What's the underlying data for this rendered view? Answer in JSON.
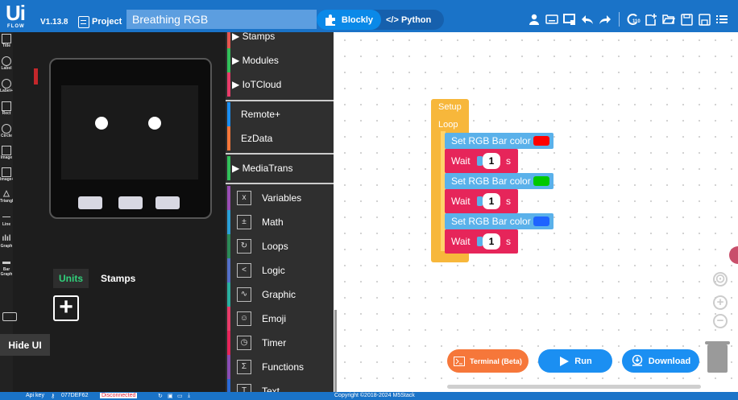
{
  "header": {
    "logo_text": "Ui",
    "logo_subtext": "FLOW",
    "version": "V1.13.8",
    "project_label": "Project",
    "project_name": "Breathing RGB",
    "modes": {
      "blockly": "Blockly",
      "python": "</> Python"
    },
    "counter_badge": "110",
    "icons": [
      "user-icon",
      "keyboard-icon",
      "device-icon",
      "undo-icon",
      "redo-icon",
      "settings-icon",
      "new-file-icon",
      "open-folder-icon",
      "save-icon",
      "save-as-icon",
      "menu-icon"
    ]
  },
  "tools": [
    {
      "label": "Title"
    },
    {
      "label": "Label"
    },
    {
      "label": "Label+"
    },
    {
      "label": "Rect"
    },
    {
      "label": "Circle"
    },
    {
      "label": "Image"
    },
    {
      "label": "Image+"
    },
    {
      "label": "Triangle"
    },
    {
      "label": "Line"
    },
    {
      "label": "Graph"
    },
    {
      "label": "Bar Graph"
    }
  ],
  "device_panel": {
    "units_tab": "Units",
    "stamps_tab": "Stamps",
    "hide_ui": "Hide UI"
  },
  "toolbox": {
    "categories": [
      {
        "label": "Stamps",
        "color": "#e5564f",
        "expandable": true
      },
      {
        "label": "Modules",
        "color": "#32c05a",
        "expandable": true
      },
      {
        "label": "IoTCloud",
        "color": "#e83c6a",
        "expandable": true
      },
      {
        "label": "Remote+",
        "color": "#1b8ff2",
        "expandable": false
      },
      {
        "label": "EzData",
        "color": "#f6773a",
        "expandable": false
      },
      {
        "label": "MediaTrans",
        "color": "#32c05a",
        "expandable": true
      },
      {
        "label": "Variables",
        "color": "#9a4db5",
        "icon": "variables-icon"
      },
      {
        "label": "Math",
        "color": "#2aa0d8",
        "icon": "math-icon"
      },
      {
        "label": "Loops",
        "color": "#2b8a57",
        "icon": "loops-icon"
      },
      {
        "label": "Logic",
        "color": "#5470c9",
        "icon": "logic-icon"
      },
      {
        "label": "Graphic",
        "color": "#2ab0a0",
        "icon": "graphic-icon"
      },
      {
        "label": "Emoji",
        "color": "#e83c6a",
        "icon": "emoji-icon"
      },
      {
        "label": "Timer",
        "color": "#e6255a",
        "icon": "timer-icon"
      },
      {
        "label": "Functions",
        "color": "#8a4db5",
        "icon": "functions-icon"
      },
      {
        "label": "Text",
        "color": "#2b6ad6",
        "icon": "text-icon"
      }
    ]
  },
  "workspace": {
    "setup_label": "Setup",
    "loop_label": "Loop",
    "blocks": [
      {
        "type": "rgb",
        "label": "Set RGB Bar color",
        "color": "#ff0000"
      },
      {
        "type": "wait",
        "label": "Wait",
        "value": "1",
        "unit": "s"
      },
      {
        "type": "rgb",
        "label": "Set RGB Bar color",
        "color": "#00c800"
      },
      {
        "type": "wait",
        "label": "Wait",
        "value": "1",
        "unit": "s"
      },
      {
        "type": "rgb",
        "label": "Set RGB Bar color",
        "color": "#1e64ff"
      },
      {
        "type": "wait",
        "label": "Wait",
        "value": "1",
        "unit": "s"
      }
    ]
  },
  "actions": {
    "terminal": "Terminal (Beta)",
    "run": "Run",
    "download": "Download"
  },
  "status": {
    "api_key_label": "Api key",
    "api_key": "077DEF62",
    "connection": "Disconnected",
    "copyright": "Copyright ©2018-2024 M5Stack"
  }
}
